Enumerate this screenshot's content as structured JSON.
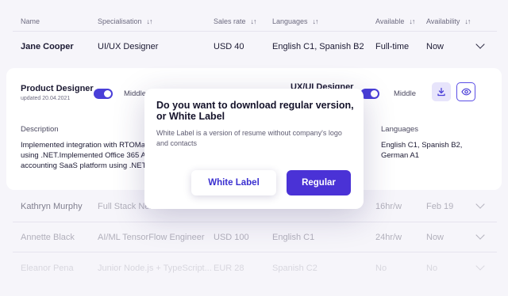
{
  "header": {
    "name": "Name",
    "specialisation": "Specialisation",
    "sales_rate": "Sales rate",
    "languages": "Languages",
    "available": "Available",
    "availability": "Availability",
    "sort_glyph": "↓↑"
  },
  "rows": [
    {
      "name": "Jane Cooper",
      "spec": "UI/UX Designer",
      "rate": "USD 40",
      "langs": "English C1, Spanish B2",
      "available": "Full-time",
      "availability": "Now"
    },
    {
      "name": "Kathryn Murphy",
      "spec": "Full Stack Nex",
      "rate": "",
      "langs": "",
      "available": "16hr/w",
      "availability": "Feb 19"
    },
    {
      "name": "Annette Black",
      "spec": "AI/ML TensorFlow Engineer",
      "rate": "USD 100",
      "langs": "English C1",
      "available": "24hr/w",
      "availability": "Now"
    },
    {
      "name": "Eleanor Pena",
      "spec": "Junior Node.js + TypeScript...",
      "rate": "EUR 28",
      "langs": "Spanish C2",
      "available": "No",
      "availability": "No"
    }
  ],
  "expanded": {
    "title": "Product Designer",
    "updated": "updated 20.04.2021",
    "level_left": "Middle",
    "role_right": "UX/UI Designer",
    "level_right": "Middle",
    "description_label": "Description",
    "description_lines": [
      "Implemented integration with RTOMa",
      "using .NET.Implemented Office 365 A",
      "accounting SaaS platform using .NET."
    ],
    "languages_label": "Languages",
    "languages_lines": [
      "English C1, Spanish B2,",
      "German A1"
    ]
  },
  "modal": {
    "title": "Do you want to download regular version, or White Label",
    "body": "White Label is a version of resume without company's logo and contacts",
    "white_label_button": "White Label",
    "regular_button": "Regular"
  },
  "colors": {
    "accent": "#4a32d6",
    "background": "#f6f5fa"
  }
}
